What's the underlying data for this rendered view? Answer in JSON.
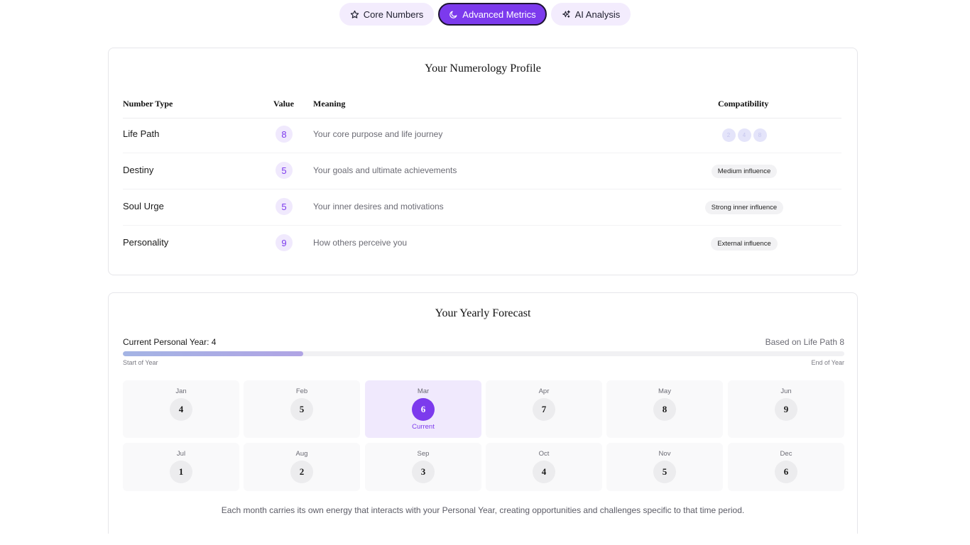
{
  "tabs": [
    {
      "label": "Core Numbers",
      "icon": "star-icon",
      "active": false
    },
    {
      "label": "Advanced Metrics",
      "icon": "moon-icon",
      "active": true
    },
    {
      "label": "AI Analysis",
      "icon": "sparkles-icon",
      "active": false
    }
  ],
  "profile": {
    "title": "Your Numerology Profile",
    "headers": {
      "type": "Number Type",
      "value": "Value",
      "meaning": "Meaning",
      "compatibility": "Compatibility"
    },
    "rows": [
      {
        "type": "Life Path",
        "value": "8",
        "meaning": "Your core purpose and life journey",
        "compat_numbers": [
          "2",
          "4",
          "8"
        ]
      },
      {
        "type": "Destiny",
        "value": "5",
        "meaning": "Your goals and ultimate achievements",
        "compat_label": "Medium influence"
      },
      {
        "type": "Soul Urge",
        "value": "5",
        "meaning": "Your inner desires and motivations",
        "compat_label": "Strong inner influence"
      },
      {
        "type": "Personality",
        "value": "9",
        "meaning": "How others perceive you",
        "compat_label": "External influence"
      }
    ]
  },
  "forecast": {
    "title": "Your Yearly Forecast",
    "personal_year_label": "Current Personal Year: 4",
    "based_on": "Based on Life Path 8",
    "year_progress": 0.25,
    "start_label": "Start of Year",
    "end_label": "End of Year",
    "current_label": "Current",
    "months": [
      {
        "name": "Jan",
        "number": "4"
      },
      {
        "name": "Feb",
        "number": "5"
      },
      {
        "name": "Mar",
        "number": "6",
        "current": true
      },
      {
        "name": "Apr",
        "number": "7"
      },
      {
        "name": "May",
        "number": "8"
      },
      {
        "name": "Jun",
        "number": "9"
      },
      {
        "name": "Jul",
        "number": "1"
      },
      {
        "name": "Aug",
        "number": "2"
      },
      {
        "name": "Sep",
        "number": "3"
      },
      {
        "name": "Oct",
        "number": "4"
      },
      {
        "name": "Nov",
        "number": "5"
      },
      {
        "name": "Dec",
        "number": "6"
      }
    ],
    "footnote": "Each month carries its own energy that interacts with your Personal Year, creating opportunities and challenges specific to that time period."
  },
  "colors": {
    "accent": "#7c3aed",
    "accent_light": "#f0e9fd"
  }
}
